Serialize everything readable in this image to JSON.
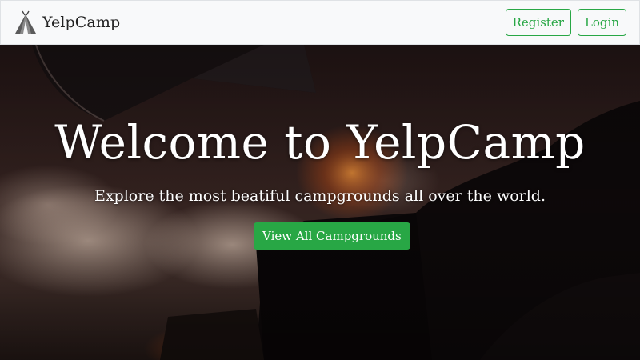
{
  "navbar": {
    "brand_name": "YelpCamp",
    "brand_icon": "tent-icon",
    "register_label": "Register",
    "login_label": "Login"
  },
  "hero": {
    "title": "Welcome to YelpCamp",
    "subtitle": "Explore the most beatiful campgrounds all over the world.",
    "cta_label": "View All Campgrounds",
    "background": "campfire-photo"
  },
  "colors": {
    "accent": "#28a745",
    "navbar_bg": "#f8f9fa",
    "hero_text": "#ffffff"
  }
}
